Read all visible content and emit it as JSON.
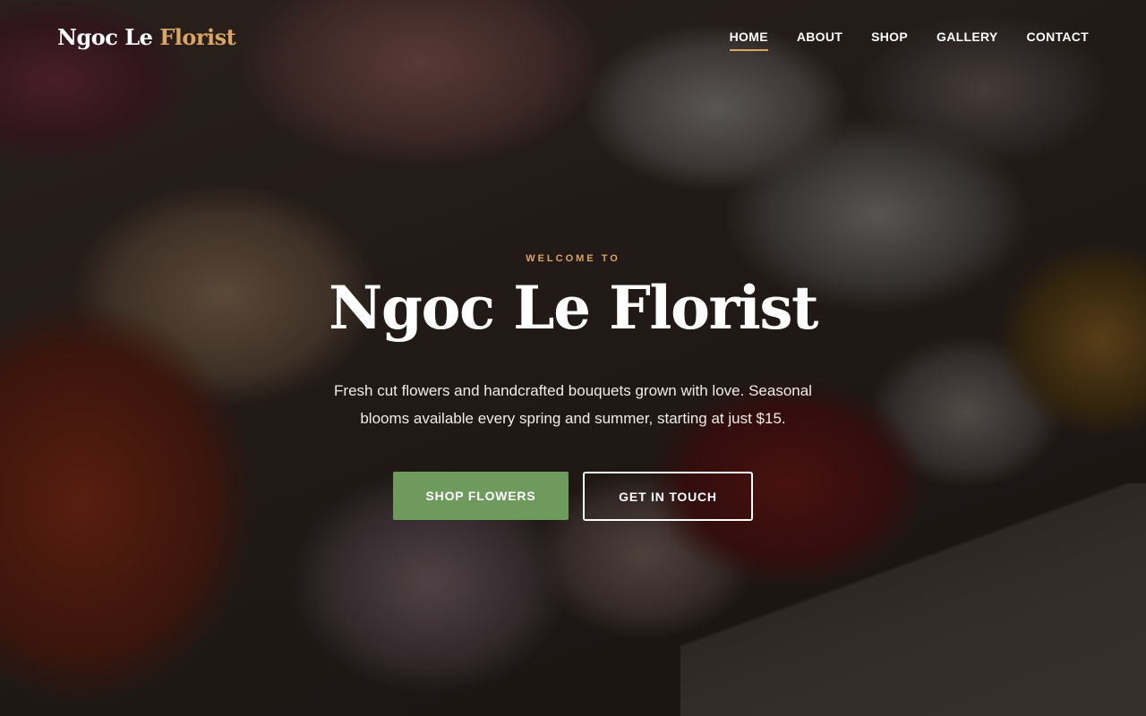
{
  "brand": {
    "name_part1": "Ngoc Le",
    "name_part2": "Florist",
    "accent_color": "#d9a560"
  },
  "nav": {
    "items": [
      {
        "label": "HOME",
        "active": true
      },
      {
        "label": "ABOUT",
        "active": false
      },
      {
        "label": "SHOP",
        "active": false
      },
      {
        "label": "GALLERY",
        "active": false
      },
      {
        "label": "CONTACT",
        "active": false
      }
    ]
  },
  "hero": {
    "eyebrow": "WELCOME TO",
    "title": "Ngoc Le Florist",
    "subtitle": "Fresh cut flowers and handcrafted bouquets grown with love. Seasonal blooms available every spring and summer, starting at just $15.",
    "primary_cta": "SHOP FLOWERS",
    "secondary_cta": "GET IN TOUCH",
    "primary_color": "#6f9a5e"
  }
}
